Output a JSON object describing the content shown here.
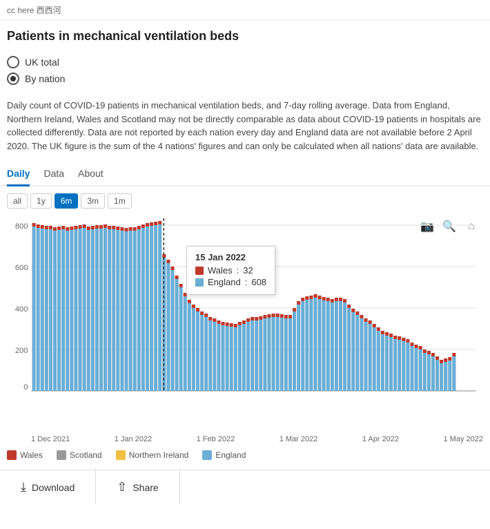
{
  "topbar": {
    "brand": "cc here 西西河"
  },
  "title": "Patients in mechanical ventilation beds",
  "radios": [
    {
      "id": "uk-total",
      "label": "UK total",
      "selected": false
    },
    {
      "id": "by-nation",
      "label": "By nation",
      "selected": true
    }
  ],
  "description": "Daily count of COVID-19 patients in mechanical ventilation beds, and 7-day rolling average. Data from England, Northern Ireland, Wales and Scotland may not be directly comparable as data about COVID-19 patients in hospitals are collected differently. Data are not reported by each nation every day and England data are not available before 2 April 2020. The UK figure is the sum of the 4 nations' figures and can only be calculated when all nations' data are available.",
  "tabs": [
    {
      "label": "Daily",
      "active": true
    },
    {
      "label": "Data",
      "active": false
    },
    {
      "label": "About",
      "active": false
    }
  ],
  "time_buttons": [
    {
      "label": "all",
      "active": false
    },
    {
      "label": "1y",
      "active": false
    },
    {
      "label": "6m",
      "active": true
    },
    {
      "label": "3m",
      "active": false
    },
    {
      "label": "1m",
      "active": false
    }
  ],
  "chart": {
    "x_labels": [
      "1 Dec 2021",
      "1 Jan 2022",
      "1 Feb 2022",
      "1 Mar 2022",
      "1 Apr 2022",
      "1 May 2022"
    ],
    "y_max": 1000,
    "tooltip": {
      "date": "15 Jan 2022",
      "wales_label": "Wales",
      "wales_value": "32",
      "england_label": "England",
      "england_value": "608"
    }
  },
  "legend": [
    {
      "label": "Wales",
      "color": "#c0392b"
    },
    {
      "label": "Scotland",
      "color": "#888"
    },
    {
      "label": "Northern Ireland",
      "color": "#f0c040"
    },
    {
      "label": "England",
      "color": "#6baed6"
    }
  ],
  "buttons": {
    "download": "Download",
    "share": "Share"
  },
  "colors": {
    "wales": "#c0392b",
    "scotland": "#999",
    "northern_ireland": "#f0c040",
    "england": "#6baed6",
    "accent": "#0070c0"
  }
}
